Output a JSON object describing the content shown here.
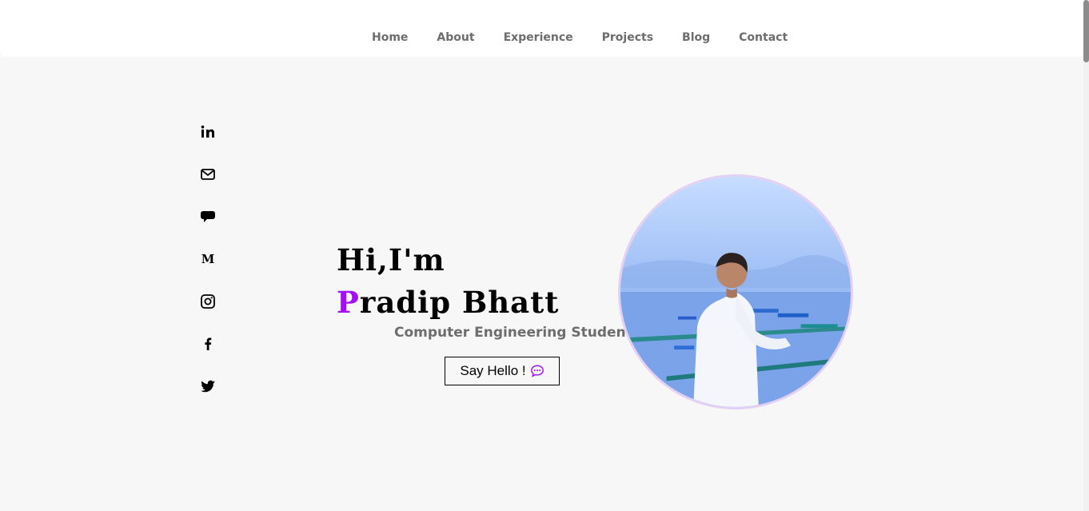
{
  "nav": {
    "items": [
      {
        "label": "Home"
      },
      {
        "label": "About"
      },
      {
        "label": "Experience"
      },
      {
        "label": "Projects"
      },
      {
        "label": "Blog"
      },
      {
        "label": "Contact"
      }
    ]
  },
  "social": {
    "icons": [
      "linkedin-icon",
      "mail-icon",
      "chat-bubble-icon",
      "medium-icon",
      "instagram-icon",
      "facebook-icon",
      "twitter-icon"
    ],
    "medium_glyph": "M"
  },
  "hero": {
    "greeting": "Hi,I'm",
    "name_first_letter": "P",
    "name_rest": "radip",
    "name_last": "Bhatt",
    "subtitle": "Computer Engineering Student",
    "cta_label": "Say Hello !"
  },
  "colors": {
    "accent": "#a20ff5",
    "nav_text": "#6d6d6d",
    "background": "#f7f7f7"
  }
}
